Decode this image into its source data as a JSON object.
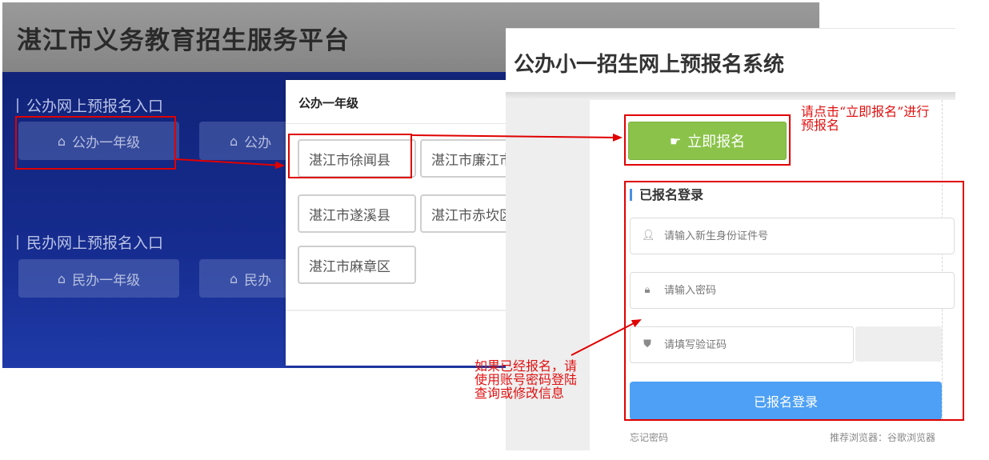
{
  "left_panel": {
    "title": "湛江市义务教育招生服务平台",
    "public_section": {
      "heading": "公办网上预报名入口",
      "buttons": [
        "公办一年级",
        "公办"
      ]
    },
    "private_section": {
      "heading": "民办网上预报名入口",
      "buttons": [
        "民办一年级",
        "民办"
      ]
    },
    "button_icon": "building-icon"
  },
  "dialog": {
    "title": "公办一年级",
    "counties": [
      "湛江市徐闻县",
      "湛江市廉江市",
      "湛江市遂溪县",
      "湛江市赤坎区",
      "湛江市麻章区"
    ]
  },
  "right_panel": {
    "title": "公办小一招生网上预报名系统",
    "apply_button": {
      "label": "立即报名",
      "icon": "hand-pointer-icon"
    },
    "login": {
      "heading": "已报名登录",
      "id_placeholder": "请输入新生身份证件号",
      "password_placeholder": "请输入密码",
      "captcha_placeholder": "请填写验证码",
      "submit_label": "已报名登录"
    },
    "forgot_password": "忘记密码",
    "browser_tip": "推荐浏览器：谷歌浏览器"
  },
  "annotations": {
    "apply_note_line1": "请点击“立即报名”进行",
    "apply_note_line2": "预报名",
    "login_note_line1": "如果已经报名，请",
    "login_note_line2": "使用账号密码登陆",
    "login_note_line3": "查询或修改信息"
  },
  "colors": {
    "annotation_red": "#e00000",
    "apply_green": "#8bc34a",
    "login_blue": "#4da0f5",
    "left_bg_blue": "#162c8f"
  }
}
